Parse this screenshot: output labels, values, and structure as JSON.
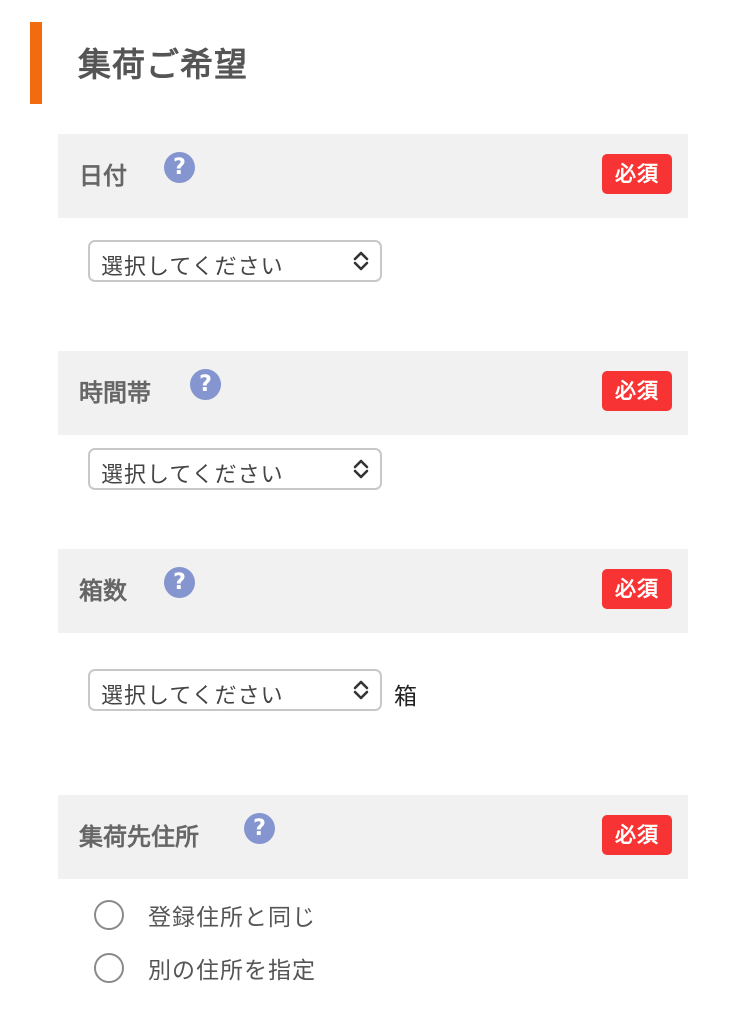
{
  "section": {
    "title": "集荷ご希望"
  },
  "fields": {
    "date": {
      "label": "日付",
      "help": "?",
      "required": "必須",
      "select_value": "選択してください"
    },
    "time_slot": {
      "label": "時間帯",
      "help": "?",
      "required": "必須",
      "select_value": "選択してください"
    },
    "box_count": {
      "label": "箱数",
      "help": "?",
      "required": "必須",
      "select_value": "選択してください",
      "unit": "箱"
    },
    "pickup_address": {
      "label": "集荷先住所",
      "help": "?",
      "required": "必須",
      "options": [
        "登録住所と同じ",
        "別の住所を指定"
      ]
    }
  },
  "colors": {
    "accent_bar": "#f26b0f",
    "required_badge": "#f73333",
    "help_icon": "#8595d0",
    "header_bg": "#f1f1f1"
  }
}
